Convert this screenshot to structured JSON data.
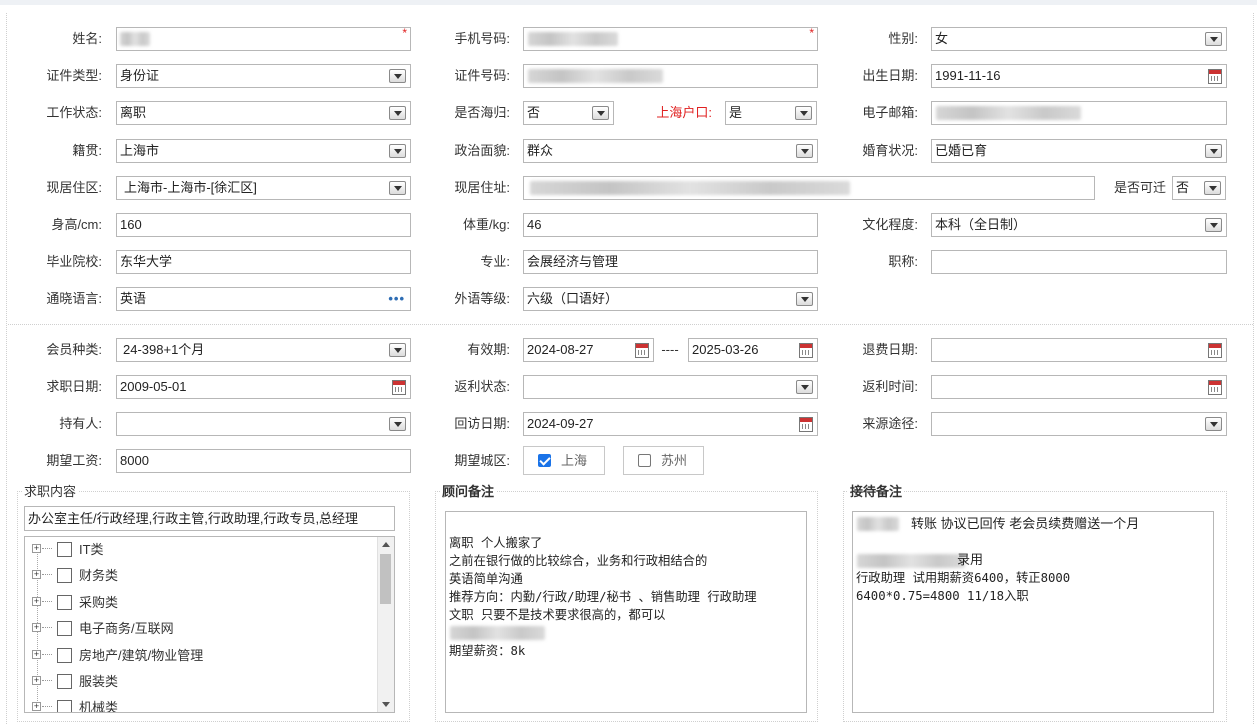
{
  "profile": {
    "name_label": "姓名:",
    "phone_label": "手机号码:",
    "gender_label": "性别:",
    "gender_value": "女",
    "id_type_label": "证件类型:",
    "id_type_value": "身份证",
    "id_no_label": "证件号码:",
    "birth_label": "出生日期:",
    "birth_value": "1991-11-16",
    "work_status_label": "工作状态:",
    "work_status_value": "离职",
    "returnee_label": "是否海归:",
    "returnee_value": "否",
    "hukou_label": "上海户口:",
    "hukou_value": "是",
    "email_label": "电子邮箱:",
    "native_label": "籍贯:",
    "native_value": "上海市",
    "political_label": "政治面貌:",
    "political_value": "群众",
    "marital_label": "婚育状况:",
    "marital_value": "已婚已育",
    "district_label": "现居住区:",
    "district_value": "上海市-上海市-[徐汇区]",
    "address_label": "现居住址:",
    "relocate_label": "是否可迁",
    "relocate_value": "否",
    "height_label": "身高/cm:",
    "height_value": "160",
    "weight_label": "体重/kg:",
    "weight_value": "46",
    "education_label": "文化程度:",
    "education_value": "本科（全日制）",
    "school_label": "毕业院校:",
    "school_value": "东华大学",
    "major_label": "专业:",
    "major_value": "会展经济与管理",
    "title_label": "职称:",
    "title_value": "",
    "language_label": "通晓语言:",
    "language_value": "英语",
    "lang_level_label": "外语等级:",
    "lang_level_value": "六级（口语好）",
    "required_mark": "*"
  },
  "membership": {
    "member_type_label": "会员种类:",
    "member_type_value": "24-398+1个月",
    "valid_label": "有效期:",
    "valid_from": "2024-08-27",
    "valid_sep": "----",
    "valid_to": "2025-03-26",
    "refund_date_label": "退费日期:",
    "refund_date_value": "",
    "job_date_label": "求职日期:",
    "job_date_value": "2009-05-01",
    "rebate_status_label": "返利状态:",
    "rebate_status_value": "",
    "rebate_time_label": "返利时间:",
    "rebate_time_value": "",
    "holder_label": "持有人:",
    "holder_value": "",
    "visit_date_label": "回访日期:",
    "visit_date_value": "2024-09-27",
    "source_label": "来源途径:",
    "source_value": "",
    "salary_label": "期望工资:",
    "salary_value": "8000",
    "city_label": "期望城区:",
    "city_options": [
      {
        "label": "上海",
        "checked": true
      },
      {
        "label": "苏州",
        "checked": false
      }
    ]
  },
  "job_content": {
    "legend": "求职内容",
    "selected_text": "办公室主任/行政经理,行政主管,行政助理,行政专员,总经理",
    "categories": [
      "IT类",
      "财务类",
      "采购类",
      "电子商务/互联网",
      "房地产/建筑/物业管理",
      "服装类",
      "机械类"
    ]
  },
  "advisor_notes": {
    "legend": "顾问备注",
    "lines": [
      "离职 个人搬家了",
      "之前在银行做的比较综合，业务和行政相结合的",
      "英语简单沟通",
      "推荐方向：内勤/行政/助理/秘书 、销售助理 行政助理",
      "文职   只要不是技术要求很高的，都可以",
      "",
      "期望薪资：8k"
    ]
  },
  "reception_notes": {
    "legend": "接待备注",
    "line1_text": "转账  协议已回传  老会员续费赠送一个月",
    "line3_text": "录用",
    "line4_text": "行政助理 试用期薪资6400，转正8000",
    "line5_text": "6400*0.75=4800 11/18入职"
  },
  "icons": {
    "dropdown": "chevron-down-icon",
    "calendar": "calendar-icon",
    "more": "more-dots-icon",
    "tree_expand": "plus-icon"
  }
}
